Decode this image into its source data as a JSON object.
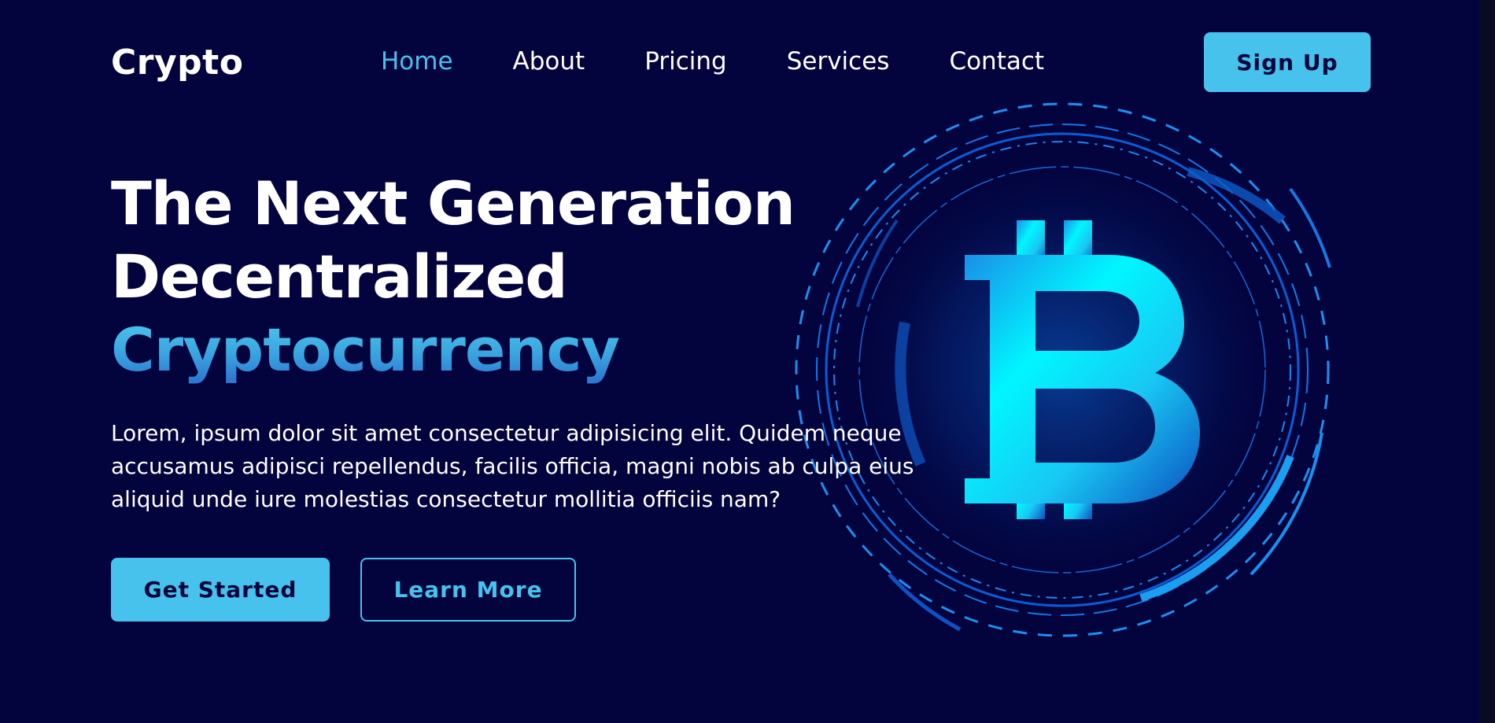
{
  "nav": {
    "logo": "Crypto",
    "links": [
      "Home",
      "About",
      "Pricing",
      "Services",
      "Contact"
    ],
    "active": "Home",
    "signup": "Sign Up"
  },
  "hero": {
    "title_line1": "The Next Generation",
    "title_line2": "Decentralized",
    "title_line3": "Cryptocurrency",
    "desc_line1": "Lorem, ipsum dolor sit amet consectetur adipisicing elit. Quidem neque",
    "desc_line2": "accusamus adipisci repellendus, facilis officia, magni nobis ab culpa eius",
    "desc_line3": "aliquid unde iure molestias consectetur mollitia officiis nam?",
    "primary_button": "Get Started",
    "secondary_button": "Learn More"
  },
  "graphic": {
    "icon": "bitcoin-icon",
    "symbol": "B"
  },
  "colors": {
    "background": "#03033d",
    "accent": "#46c2ec",
    "text": "#ffffff",
    "glow": "#00f0ff"
  }
}
